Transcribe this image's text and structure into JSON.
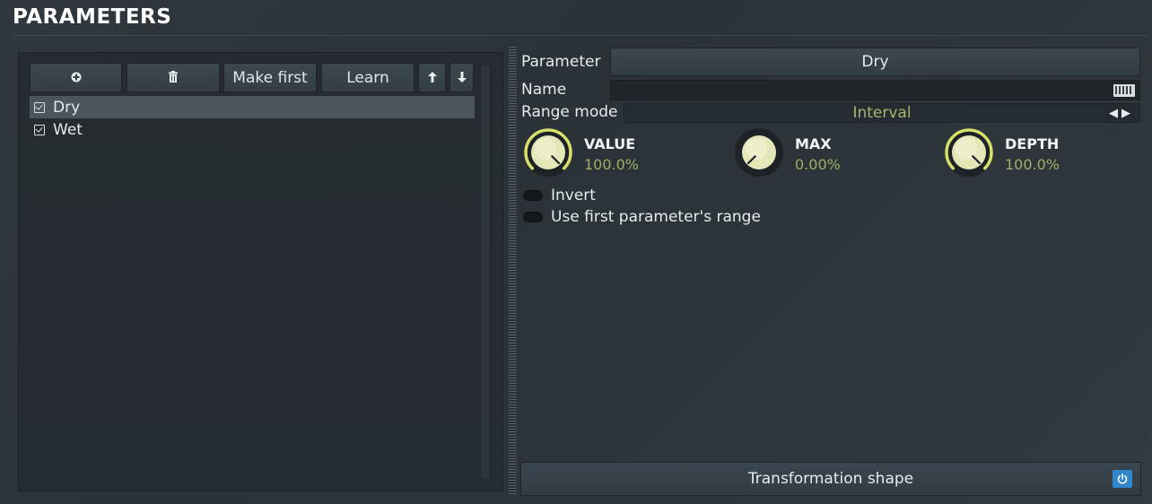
{
  "header": {
    "title": "PARAMETERS"
  },
  "toolbar": {
    "add_icon": "plus-circle-icon",
    "delete_icon": "trash-icon",
    "make_first_label": "Make first",
    "learn_label": "Learn",
    "up_icon": "arrow-up-icon",
    "down_icon": "arrow-down-icon"
  },
  "parameters_list": [
    {
      "label": "Dry",
      "checked": true,
      "selected": true
    },
    {
      "label": "Wet",
      "checked": true,
      "selected": false
    }
  ],
  "detail": {
    "parameter_label": "Parameter",
    "parameter_value": "Dry",
    "name_label": "Name",
    "name_value": "",
    "range_mode_label": "Range mode",
    "range_mode_value": "Interval",
    "knobs": [
      {
        "title": "VALUE",
        "value": "100.0%",
        "level": 1.0,
        "arc": true
      },
      {
        "title": "MAX",
        "value": "0.00%",
        "level": 0.0,
        "arc": false
      },
      {
        "title": "DEPTH",
        "value": "100.0%",
        "level": 1.0,
        "arc": true
      }
    ],
    "invert_label": "Invert",
    "invert_on": false,
    "use_first_label": "Use first parameter's range",
    "use_first_on": false,
    "transformation_label": "Transformation shape",
    "transformation_power_on": true
  },
  "colors": {
    "accent_value": "#a9b56a",
    "knob_arc": "#d9e06a",
    "power_blue": "#2f86c8"
  }
}
